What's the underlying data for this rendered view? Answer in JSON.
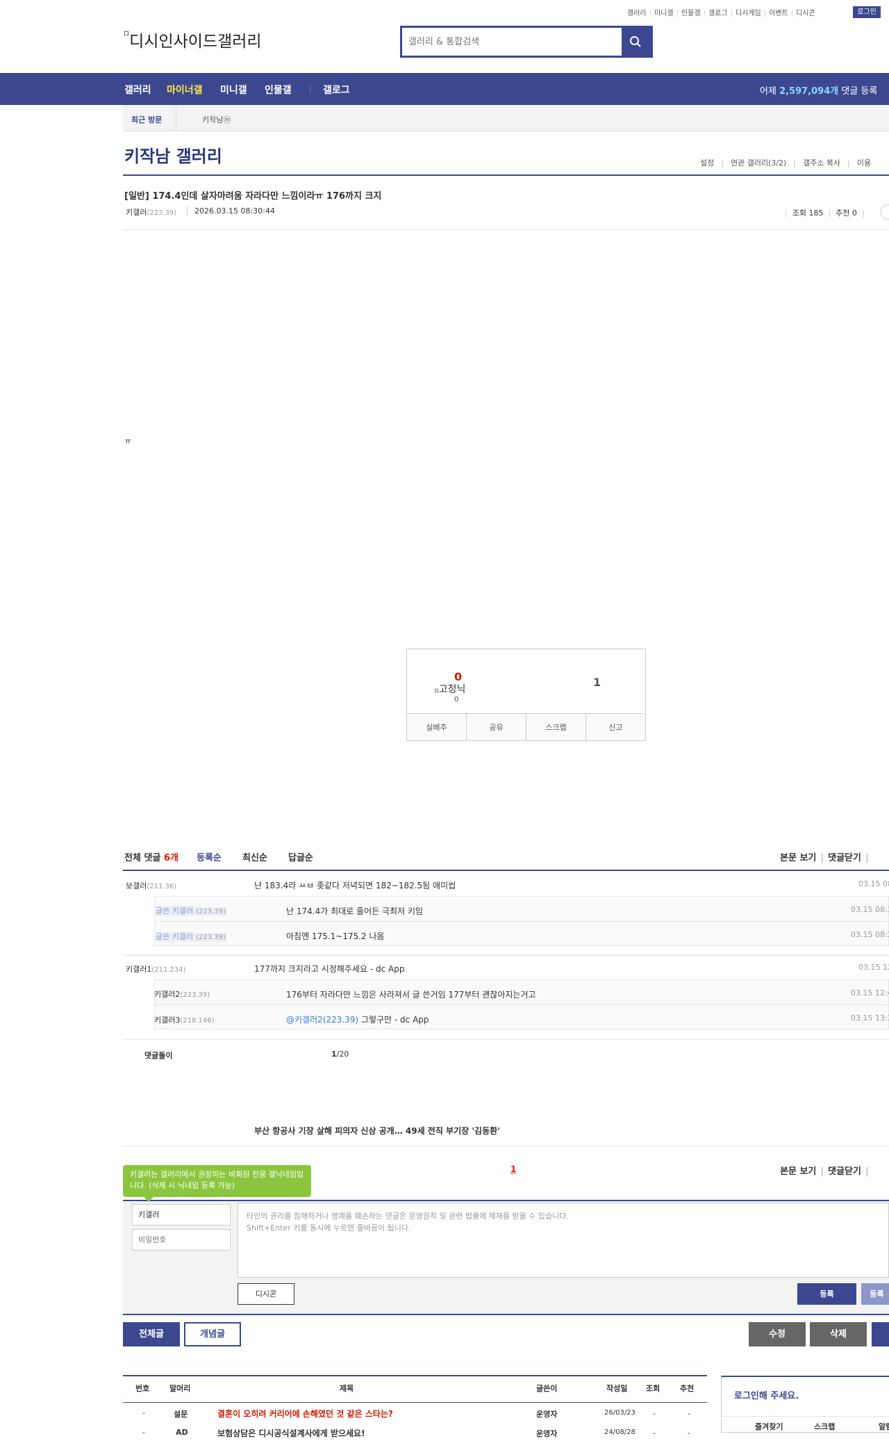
{
  "top_links": [
    "갤러리",
    "미니갤",
    "인물갤",
    "갤로그",
    "디시게임",
    "이벤트",
    "디시콘"
  ],
  "login_label": "로그인",
  "logo_text": "디시인사이드갤러리",
  "search": {
    "placeholder": "갤러리 & 통합검색"
  },
  "nav": {
    "items": [
      "갤러리",
      "마이너갤",
      "미니갤",
      "인물갤",
      "갤로그"
    ],
    "stat_prefix": "어제",
    "stat_value": "2,597,094개",
    "stat_suffix": "댓글 등록"
  },
  "recent": {
    "label": "최근 방문",
    "item": "키작남ⓜ"
  },
  "gallery": {
    "title": "키작남 갤러리",
    "menu": [
      "설정",
      "연관 갤러리(3/2)",
      "갤주소 복사",
      "이용"
    ]
  },
  "post": {
    "title": "[일반] 174.4인데 살자마려움 자라다만 느낌이라ㅠ 176까지 크지",
    "author": "키갤러",
    "author_ip": "(223.39)",
    "date": "2026.03.15 08:30:44",
    "views_label": "조회 185",
    "recommend_label": "추천 0",
    "body": "ㅠ"
  },
  "vote": {
    "up_count": "0",
    "fixed_nick_alt": "고정닉",
    "fixed_count": "0",
    "down_count": "1",
    "buttons": [
      "실베추",
      "공유",
      "스크랩",
      "신고"
    ]
  },
  "comments": {
    "header_label": "전체 댓글",
    "count": "6개",
    "sort": [
      "등록순",
      "최신순",
      "답글순"
    ],
    "right_links": [
      "본문 보기",
      "댓글닫기"
    ],
    "items": [
      {
        "nick": "보갤러",
        "ip": "(211.36)",
        "text": "난 183.4라 ㅆㅂ 좆같다 저녁되면 182~182.5됨 애미씹",
        "date": "03.15 08"
      },
      {
        "nick": "글쓴 키갤러",
        "ip": "(223.39)",
        "text": "난 174.4가 최대로 줄어든 극최저 키임",
        "date": "03.15 08:3"
      },
      {
        "nick": "글쓴 키갤러",
        "ip": "(223.39)",
        "text": "아침엔 175.1~175.2 나옴",
        "date": "03.15 08:3"
      },
      {
        "nick": "키갤러1",
        "ip": "(211.234)",
        "text": "177까지 크지라고 시정해주세요 - dc App",
        "date": "03.15 12"
      },
      {
        "nick": "키갤러2",
        "ip": "(223.39)",
        "text": "176부터 자라다만 느낌은 사라져서 글 쓴거임 177부터 괜찮아지는거고",
        "date": "03.15 12:4"
      },
      {
        "nick": "키갤러3",
        "ip": "(218.146)",
        "mention": "@키갤러2(223.39)",
        "text": "그렇구만 - dc App",
        "date": "03.15 13:3"
      }
    ],
    "dolgi_label": "댓글돌이",
    "page": "1",
    "page_total": "/20"
  },
  "news_headline": "부산 항공사 기장 살해 피의자 신상 공개… 49세 전직 부기장 '김동환'",
  "page_current": "1",
  "write": {
    "tooltip": "키갤러는 갤러리에서 권장하는 비회원 전용 갤닉네임입니다. (삭제 시 닉네임 등록 가능)",
    "nick_value": "키갤러",
    "password_placeholder": "비밀번호",
    "textarea_line1": "타인의 권리를 침해하거나 명예를 훼손하는 댓글은 운영원칙 및 관련 법률에 제재를 받을 수 있습니다.",
    "textarea_line2": "Shift+Enter 키를 동시에 누르면 줄바꿈이 됩니다.",
    "dccon_label": "디시콘",
    "register_label": "등록",
    "register2_label": "등록"
  },
  "bottom_buttons": {
    "all": "전체글",
    "concept": "개념글",
    "edit": "수정",
    "delete": "삭제"
  },
  "list": {
    "headers": [
      "번호",
      "말머리",
      "제목",
      "글쓴이",
      "작성일",
      "조회",
      "추천"
    ],
    "rows": [
      {
        "no": "-",
        "head": "설문",
        "title": "결혼이 오히려 커리어에 손해였던 것 같은 스타는?",
        "writer": "운영자",
        "date": "26/03/23",
        "views": "-",
        "rec": "-"
      },
      {
        "no": "-",
        "head": "AD",
        "title": "보험상담은 디시공식설계사에게 받으세요!",
        "writer": "운영자",
        "date": "24/08/28",
        "views": "-",
        "rec": "-"
      }
    ]
  },
  "loginbox": {
    "title": "로그인해 주세요.",
    "links": [
      "즐겨찾기",
      "스크랩",
      "알림"
    ]
  }
}
